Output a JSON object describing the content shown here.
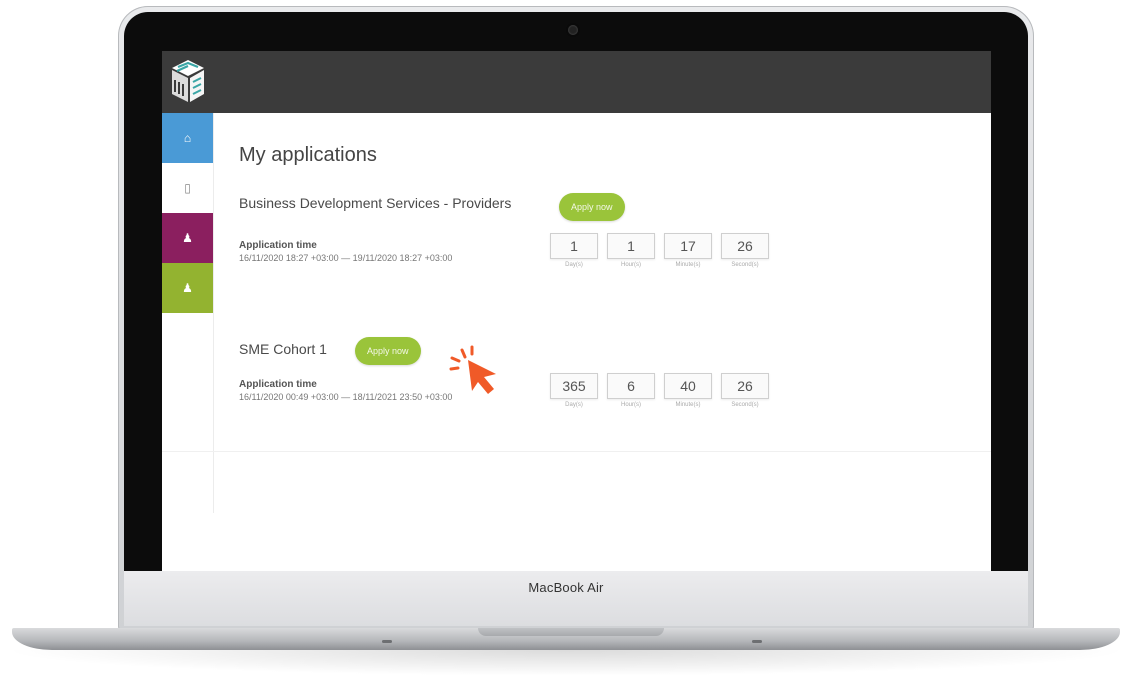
{
  "device": {
    "brand_label": "MacBook Air"
  },
  "app": {
    "page_title": "My applications",
    "sidebar": [
      {
        "icon": "home-icon",
        "glyph": "⌂"
      },
      {
        "icon": "document-icon",
        "glyph": "▯"
      },
      {
        "icon": "user-group-icon",
        "glyph": "♟"
      },
      {
        "icon": "users-icon",
        "glyph": "♟"
      }
    ],
    "programs": [
      {
        "name": "Business Development Services - Providers",
        "apply_label": "Apply now",
        "time_label": "Application time",
        "time_range": "16/11/2020 18:27 +03:00 — 19/11/2020 18:27 +03:00",
        "countdown": [
          {
            "value": "1",
            "unit": "Day(s)"
          },
          {
            "value": "1",
            "unit": "Hour(s)"
          },
          {
            "value": "17",
            "unit": "Minute(s)"
          },
          {
            "value": "26",
            "unit": "Second(s)"
          }
        ]
      },
      {
        "name": "SME Cohort 1",
        "apply_label": "Apply now",
        "time_label": "Application time",
        "time_range": "16/11/2020 00:49 +03:00 — 18/11/2021 23:50 +03:00",
        "countdown": [
          {
            "value": "365",
            "unit": "Day(s)"
          },
          {
            "value": "6",
            "unit": "Hour(s)"
          },
          {
            "value": "40",
            "unit": "Minute(s)"
          },
          {
            "value": "26",
            "unit": "Second(s)"
          }
        ]
      }
    ]
  },
  "colors": {
    "topbar": "#3b3b3b",
    "home": "#4a9ad6",
    "magenta": "#8b1f5f",
    "green": "#93b330",
    "apply_button": "#9ac43a",
    "cursor": "#f05a28"
  }
}
